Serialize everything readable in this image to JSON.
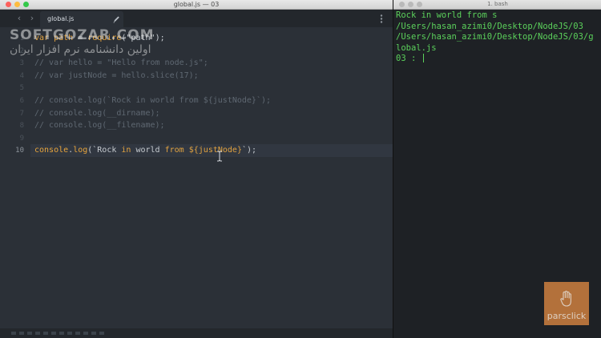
{
  "editor": {
    "window_title": "global.js — 03",
    "tab": {
      "label": "global.js"
    },
    "lines": [
      {
        "num": "1",
        "parts": [
          {
            "t": "var ",
            "c": "kw"
          },
          {
            "t": "path",
            "c": "kw"
          },
          {
            "t": " = ",
            "c": ""
          },
          {
            "t": "require",
            "c": "fn"
          },
          {
            "t": "(",
            "c": ""
          },
          {
            "t": "\"path\"",
            "c": "str"
          },
          {
            "t": ");",
            "c": ""
          }
        ]
      },
      {
        "num": "2",
        "parts": []
      },
      {
        "num": "3",
        "parts": [
          {
            "t": "// var hello = \"Hello from node.js\";",
            "c": "cm"
          }
        ]
      },
      {
        "num": "4",
        "parts": [
          {
            "t": "// var justNode = hello.slice(17);",
            "c": "cm"
          }
        ]
      },
      {
        "num": "5",
        "parts": []
      },
      {
        "num": "6",
        "parts": [
          {
            "t": "// console.log(`Rock in world from ${justNode}`);",
            "c": "cm"
          }
        ]
      },
      {
        "num": "7",
        "parts": [
          {
            "t": "// console.log(__dirname);",
            "c": "cm"
          }
        ]
      },
      {
        "num": "8",
        "parts": [
          {
            "t": "// console.log(__filename);",
            "c": "cm"
          }
        ]
      },
      {
        "num": "9",
        "parts": []
      },
      {
        "num": "10",
        "parts": [
          {
            "t": "console",
            "c": "fn"
          },
          {
            "t": ".",
            "c": ""
          },
          {
            "t": "log",
            "c": "fn"
          },
          {
            "t": "(`Rock ",
            "c": "str"
          },
          {
            "t": "in",
            "c": "kw"
          },
          {
            "t": " world ",
            "c": "str"
          },
          {
            "t": "from",
            "c": "kw"
          },
          {
            "t": " ",
            "c": "str"
          },
          {
            "t": "${justNode}",
            "c": "tp"
          },
          {
            "t": "`);",
            "c": "str"
          }
        ]
      }
    ]
  },
  "watermark": {
    "site": "SOFTGOZAR.COM",
    "tagline_fa": "اولین دانشنامه نرم افزار ایران"
  },
  "terminal": {
    "title": "1. bash",
    "lines": [
      "Rock in world from s",
      "/Users/hasan_azimi0/Desktop/NodeJS/03",
      "/Users/hasan_azimi0/Desktop/NodeJS/03/g",
      "lobal.js"
    ],
    "prompt": "03 : "
  },
  "logo": {
    "text": "parsclick"
  },
  "colors": {
    "editor_bg": "#2b3037",
    "terminal_bg": "#1e2125",
    "terminal_text": "#5bd15b",
    "keyword": "#e2a341",
    "comment": "#5f6872",
    "logo_bg": "#c47a3e"
  }
}
